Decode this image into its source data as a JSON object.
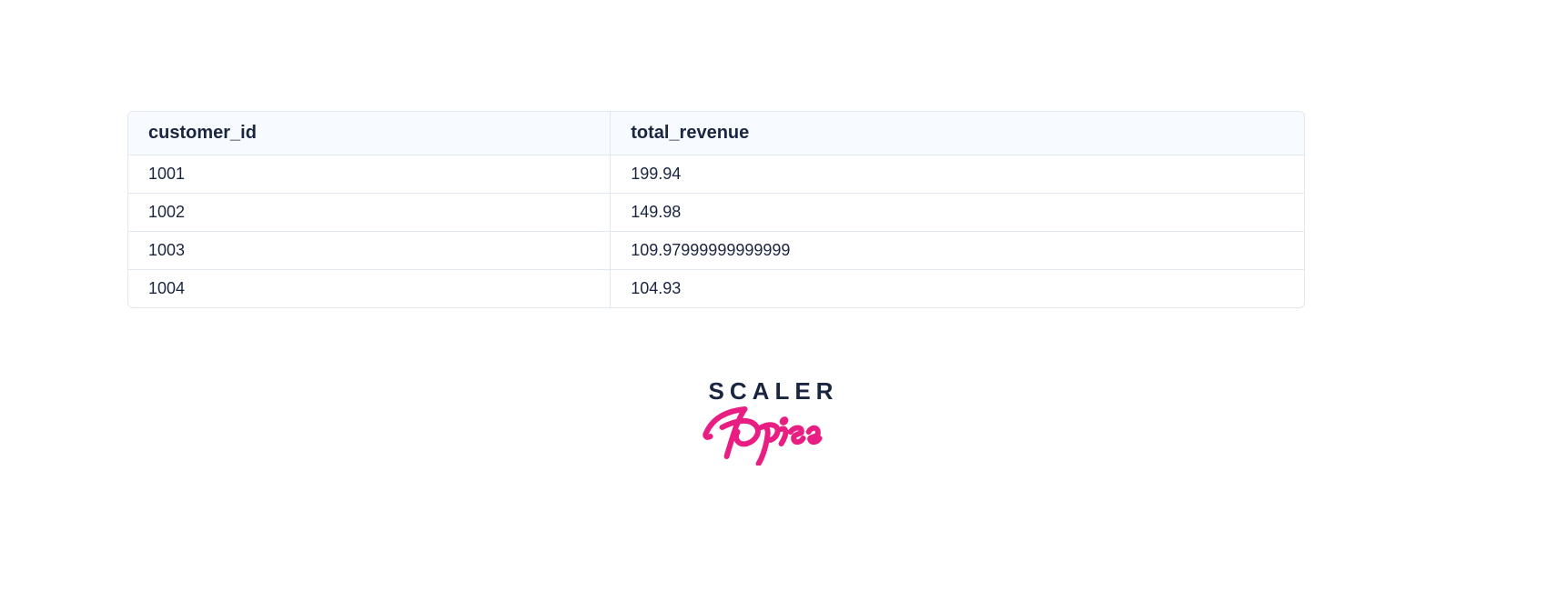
{
  "chart_data": {
    "type": "table",
    "columns": [
      "customer_id",
      "total_revenue"
    ],
    "rows": [
      [
        "1001",
        "199.94"
      ],
      [
        "1002",
        "149.98"
      ],
      [
        "1003",
        "109.97999999999999"
      ],
      [
        "1004",
        "104.93"
      ]
    ]
  },
  "logo": {
    "line1": "SCALER",
    "line2": "Topics"
  }
}
